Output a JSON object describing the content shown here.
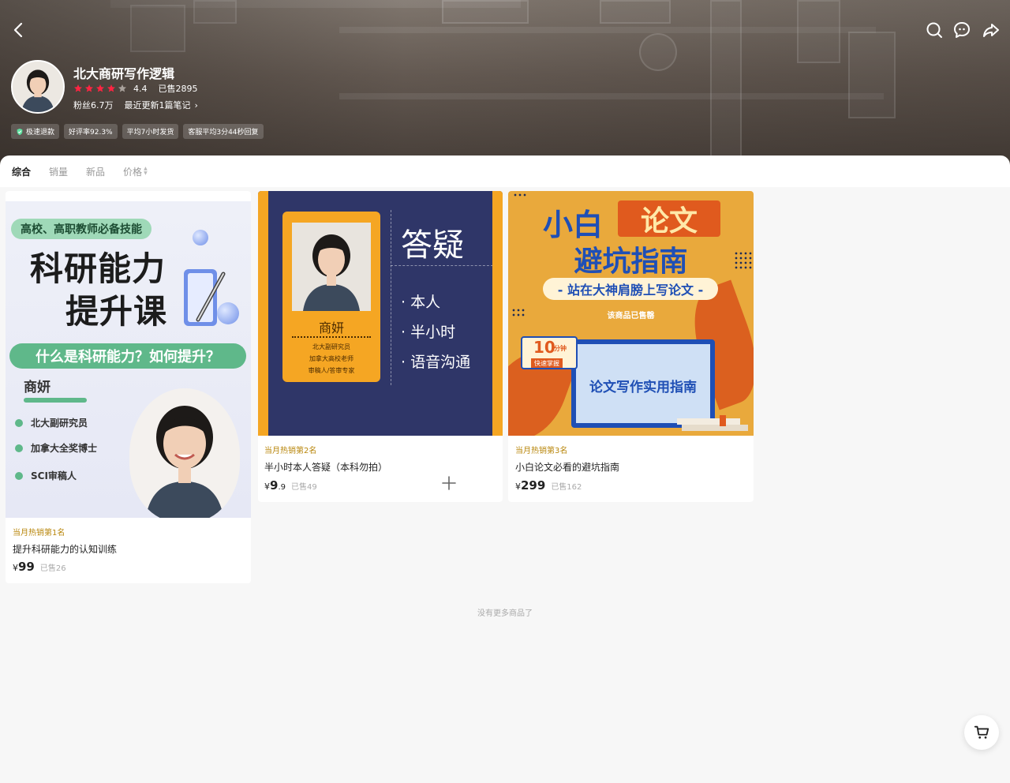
{
  "header": {
    "shop_name": "北大商研写作逻辑",
    "rating": "4.4",
    "sold_total": "已售2895",
    "fans": "粉丝6.7万",
    "updates": "最近更新1篇笔记",
    "badges": [
      "极速退款",
      "好评率92.3%",
      "平均7小时发货",
      "客服平均3分44秒回复"
    ],
    "icons": [
      "back-arrow-icon",
      "search-icon",
      "message-icon",
      "share-icon"
    ]
  },
  "sort_tabs": [
    "综合",
    "销量",
    "新品",
    "价格"
  ],
  "products": [
    {
      "rank": "当月热销第1名",
      "title": "提升科研能力的认知训练",
      "price_currency": "¥",
      "price_int": "99",
      "price_dec": "",
      "sold": "已售26",
      "cover": {
        "tag": "高校、高职教师必备技能",
        "headline_1": "科研能力",
        "headline_2": "提升课",
        "question": "什么是科研能力？如何提升？",
        "name": "商妍",
        "bullets": [
          "北大副研究员",
          "加拿大全奖博士",
          "SCI审稿人"
        ]
      }
    },
    {
      "rank": "当月热销第2名",
      "title": "半小时本人答疑（本科勿拍）",
      "price_currency": "¥",
      "price_int": "9",
      "price_dec": ".9",
      "sold": "已售49",
      "cover": {
        "name": "商妍",
        "lines": [
          "北大副研究员",
          "加拿大高校老师",
          "审稿人/答审专家"
        ],
        "headline": "答疑",
        "items": [
          "· 本人",
          "· 半小时",
          "· 语音沟通"
        ]
      }
    },
    {
      "rank": "当月热销第3名",
      "title": "小白论文必看的避坑指南",
      "price_currency": "¥",
      "price_int": "299",
      "price_dec": "",
      "sold": "已售162",
      "cover": {
        "title_a": "小白",
        "title_b": "论文",
        "title_c": "避坑指南",
        "subtitle": "- 站在大神肩膀上写论文 -",
        "sold_out": "该商品已售罄",
        "clock_num": "10",
        "clock_unit": "分钟",
        "clock_tag": "快速掌握",
        "monitor_text": "论文写作实用指南"
      }
    }
  ],
  "no_more": "没有更多商品了",
  "colors": {
    "accent_green": "#5fb88a",
    "accent_orange": "#f5a623",
    "navy": "#2f3668",
    "rank_gold": "#b8860b",
    "star_red": "#ff2442"
  }
}
